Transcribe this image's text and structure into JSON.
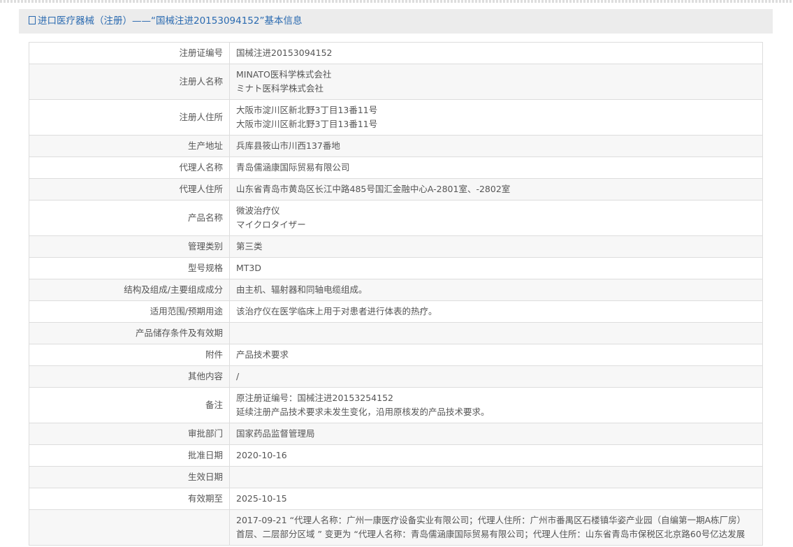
{
  "title": "进口医疗器械（注册）——“国械注进20153094152”基本信息",
  "rows": [
    {
      "label": "注册证编号",
      "lines": [
        "国械注进20153094152"
      ]
    },
    {
      "label": "注册人名称",
      "lines": [
        "MINATO医科学株式会社",
        "ミナト医科学株式会社"
      ]
    },
    {
      "label": "注册人住所",
      "lines": [
        "大阪市淀川区新北野3丁目13番11号",
        "大阪市淀川区新北野3丁目13番11号"
      ]
    },
    {
      "label": "生产地址",
      "lines": [
        "兵库县筱山市川西137番地"
      ]
    },
    {
      "label": "代理人名称",
      "lines": [
        "青岛儒涵康国际贸易有限公司"
      ]
    },
    {
      "label": "代理人住所",
      "lines": [
        "山东省青岛市黄岛区长江中路485号国汇金融中心A-2801室、-2802室"
      ]
    },
    {
      "label": "产品名称",
      "lines": [
        "微波治疗仪",
        "マイクロタイザー"
      ]
    },
    {
      "label": "管理类别",
      "lines": [
        "第三类"
      ]
    },
    {
      "label": "型号规格",
      "lines": [
        "MT3D"
      ]
    },
    {
      "label": "结构及组成/主要组成成分",
      "lines": [
        "由主机、辐射器和同轴电缆组成。"
      ]
    },
    {
      "label": "适用范围/预期用途",
      "lines": [
        "该治疗仪在医学临床上用于对患者进行体表的热疗。"
      ]
    },
    {
      "label": "产品储存条件及有效期",
      "lines": [
        ""
      ]
    },
    {
      "label": "附件",
      "lines": [
        "产品技术要求"
      ]
    },
    {
      "label": "其他内容",
      "lines": [
        "/"
      ]
    },
    {
      "label": "备注",
      "lines": [
        "原注册证编号：国械注进20153254152",
        "延续注册产品技术要求未发生变化，沿用原核发的产品技术要求。"
      ]
    },
    {
      "label": "审批部门",
      "lines": [
        "国家药品监督管理局"
      ]
    },
    {
      "label": "批准日期",
      "lines": [
        "2020-10-16"
      ]
    },
    {
      "label": "生效日期",
      "lines": [
        ""
      ]
    },
    {
      "label": "有效期至",
      "lines": [
        "2025-10-15"
      ]
    },
    {
      "label": "",
      "lines": [
        "2017-09-21 “代理人名称：广州一康医疗设备实业有限公司；代理人住所：广州市番禺区石楼镇华姿产业园（自编第一期A栋厂房）",
        "首层、二层部分区域 ” 变更为 “代理人名称：青岛儒涵康国际贸易有限公司；代理人住所：山东省青岛市保税区北京路60号亿达发展"
      ]
    }
  ]
}
